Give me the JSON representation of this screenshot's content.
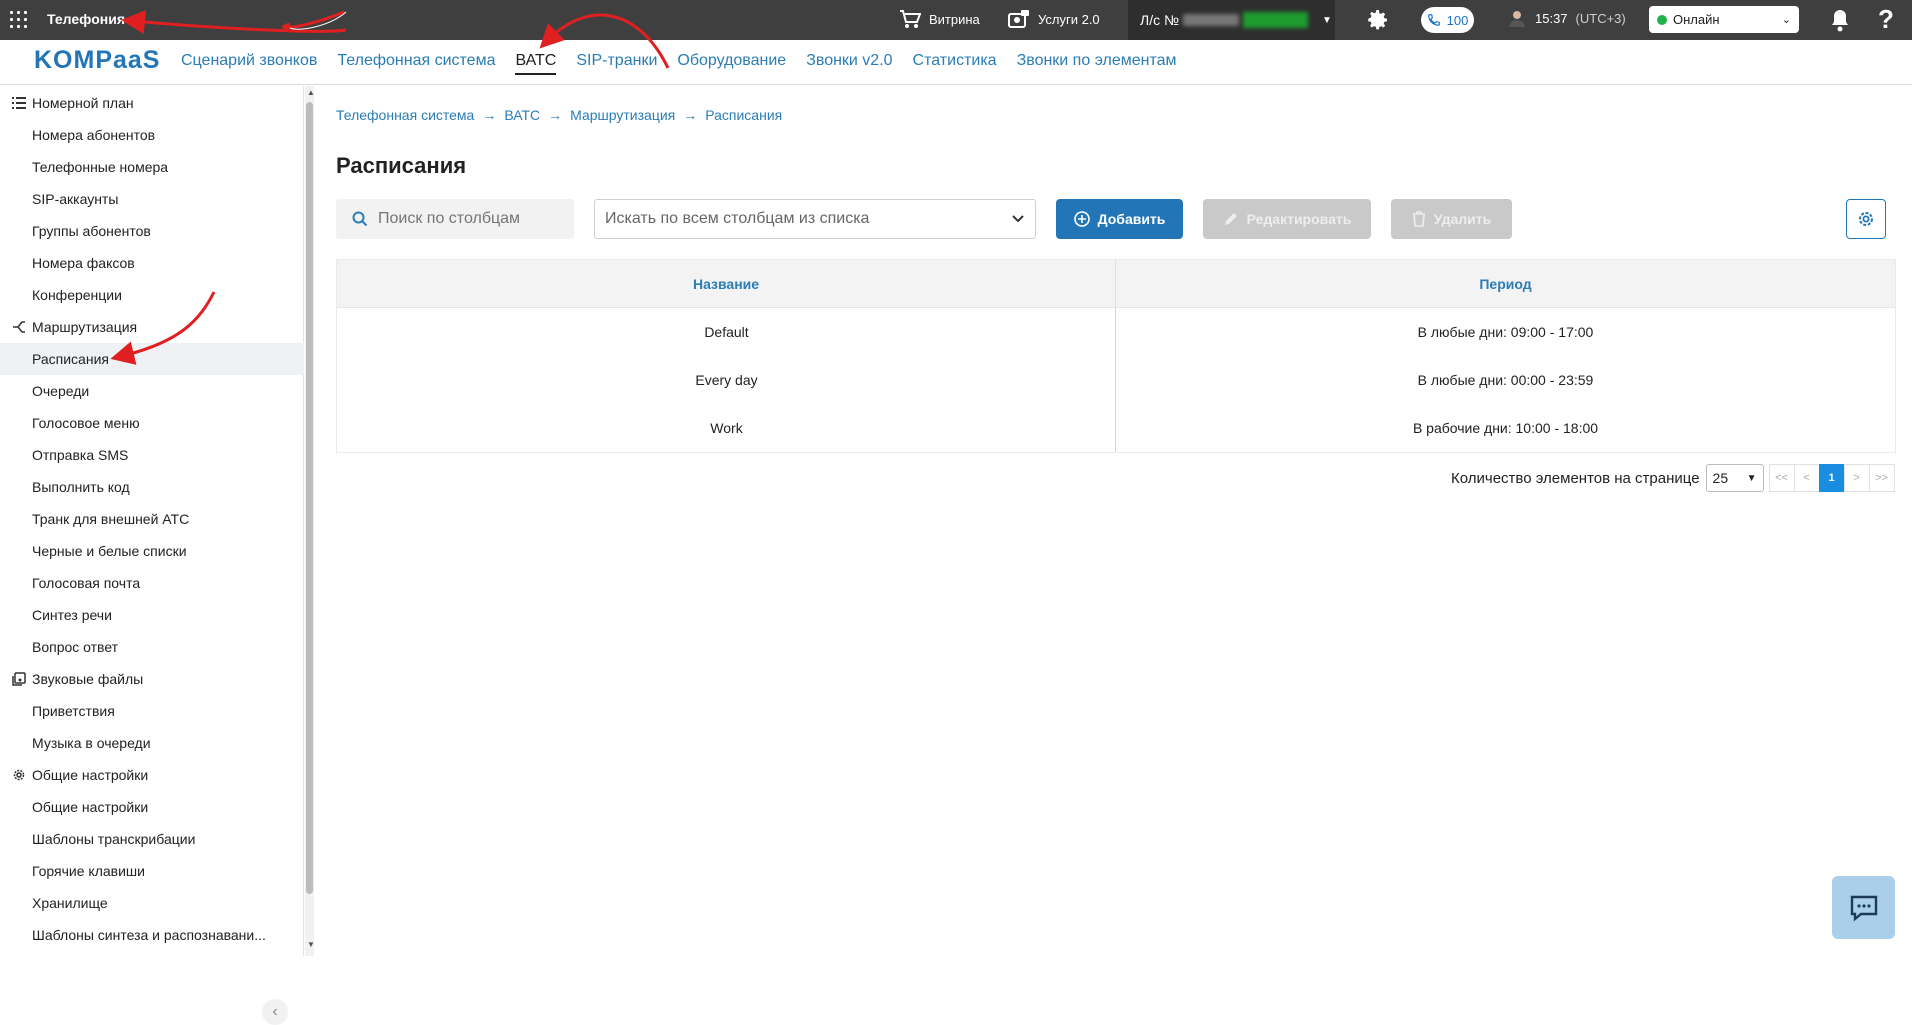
{
  "topbar": {
    "app_title": "Телефония",
    "showcase_label": "Витрина",
    "services_label": "Услуги 2.0",
    "account_label": "Л/с №",
    "calls_count": "100",
    "time": "15:37",
    "timezone": "(UTC+3)",
    "status_value": "Онлайн",
    "help_label": "?"
  },
  "logo": "KOMPaaS",
  "nav": {
    "tabs": [
      {
        "label": "Сценарий звонков"
      },
      {
        "label": "Телефонная система"
      },
      {
        "label": "ВАТС"
      },
      {
        "label": "SIP-транки"
      },
      {
        "label": "Оборудование"
      },
      {
        "label": "Звонки v2.0"
      },
      {
        "label": "Статистика"
      },
      {
        "label": "Звонки по элементам"
      }
    ]
  },
  "sidebar": {
    "items": [
      {
        "label": "Номерной план"
      },
      {
        "label": "Номера абонентов"
      },
      {
        "label": "Телефонные номера"
      },
      {
        "label": "SIP-аккаунты"
      },
      {
        "label": "Группы абонентов"
      },
      {
        "label": "Номера факсов"
      },
      {
        "label": "Конференции"
      },
      {
        "label": "Маршрутизация"
      },
      {
        "label": "Расписания"
      },
      {
        "label": "Очереди"
      },
      {
        "label": "Голосовое меню"
      },
      {
        "label": "Отправка SMS"
      },
      {
        "label": "Выполнить код"
      },
      {
        "label": "Транк для внешней АТС"
      },
      {
        "label": "Черные и белые списки"
      },
      {
        "label": "Голосовая почта"
      },
      {
        "label": "Синтез речи"
      },
      {
        "label": "Вопрос ответ"
      },
      {
        "label": "Звуковые файлы"
      },
      {
        "label": "Приветствия"
      },
      {
        "label": "Музыка в очереди"
      },
      {
        "label": "Общие настройки"
      },
      {
        "label": "Общие настройки"
      },
      {
        "label": "Шаблоны транскрибации"
      },
      {
        "label": "Горячие клавиши"
      },
      {
        "label": "Хранилище"
      },
      {
        "label": "Шаблоны синтеза и распознавани..."
      }
    ]
  },
  "breadcrumb": [
    "Телефонная система",
    "ВАТС",
    "Маршрутизация",
    "Расписания"
  ],
  "page_title": "Расписания",
  "toolbar": {
    "search_placeholder": "Поиск по столбцам",
    "columns_select": "Искать по всем столбцам из списка",
    "add_label": "Добавить",
    "edit_label": "Редактировать",
    "delete_label": "Удалить"
  },
  "table": {
    "headers": [
      "Название",
      "Период"
    ],
    "rows": [
      {
        "name": "Default",
        "period": "В любые дни: 09:00 - 17:00"
      },
      {
        "name": "Every day",
        "period": "В любые дни: 00:00 - 23:59"
      },
      {
        "name": "Work",
        "period": "В рабочие дни: 10:00 - 18:00"
      }
    ]
  },
  "pager": {
    "label": "Количество элементов на странице",
    "page_size": "25",
    "first": "<<",
    "prev": "<",
    "current": "1",
    "next": ">",
    "last": ">>"
  },
  "colors": {
    "topbar_bg": "#3f3f3f",
    "accent": "#2276b8",
    "link": "#2b7db4",
    "online": "#1fb24a",
    "annotation_arrow": "#e02020"
  }
}
